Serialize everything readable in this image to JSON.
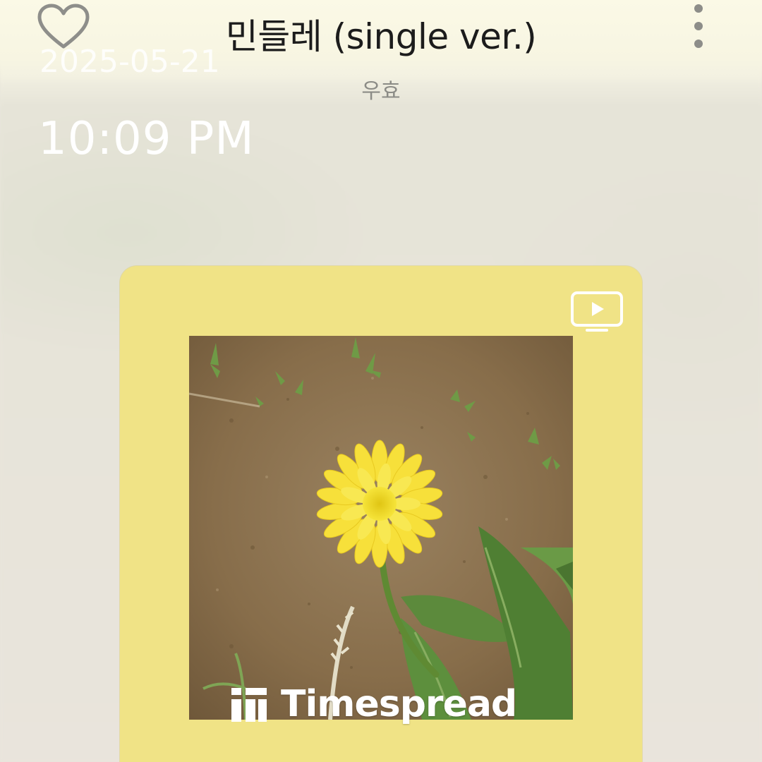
{
  "header": {
    "song_title": "민들레 (single ver.)",
    "artist": "우효",
    "like_icon": "heart-outline-icon",
    "more_icon": "more-vertical-icon"
  },
  "overlay": {
    "date": "2025-05-21",
    "time": "10:09 PM"
  },
  "player": {
    "card_color": "#f0e386",
    "video_icon": "video-play-icon",
    "album_art": {
      "subject": "yellow dandelion flower on soil",
      "watermark": "Timespread"
    }
  }
}
